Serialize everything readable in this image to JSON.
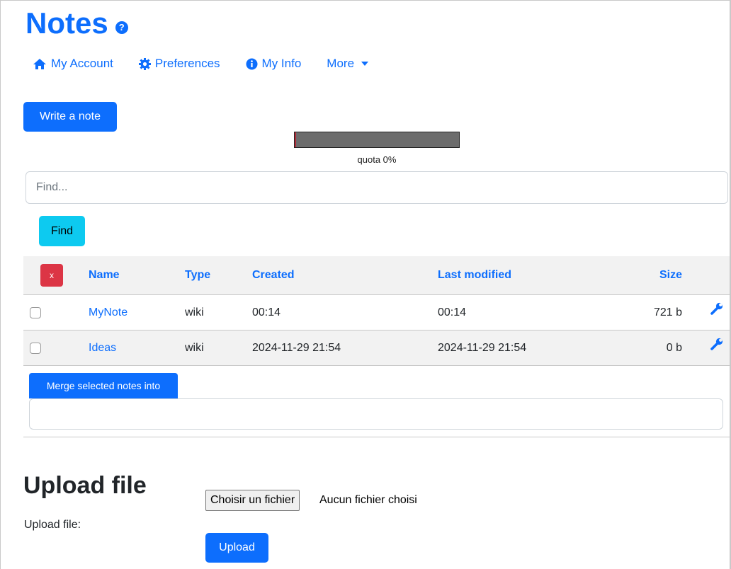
{
  "page": {
    "title": "Notes"
  },
  "nav": {
    "items": [
      {
        "label": "My Account",
        "icon": "home-icon"
      },
      {
        "label": "Preferences",
        "icon": "gear-icon"
      },
      {
        "label": "My Info",
        "icon": "info-icon"
      },
      {
        "label": "More",
        "icon": "caret-down-icon"
      }
    ]
  },
  "actions": {
    "write_note": "Write a note"
  },
  "quota": {
    "label": "quota 0%",
    "percent": 0
  },
  "search": {
    "placeholder": "Find...",
    "button": "Find"
  },
  "table": {
    "delete_label": "x",
    "columns": {
      "name": "Name",
      "type": "Type",
      "created": "Created",
      "modified": "Last modified",
      "size": "Size"
    },
    "rows": [
      {
        "name": "MyNote",
        "type": "wiki",
        "created": "00:14",
        "modified": "00:14",
        "size": "721 b"
      },
      {
        "name": "Ideas",
        "type": "wiki",
        "created": "2024-11-29 21:54",
        "modified": "2024-11-29 21:54",
        "size": "0 b"
      }
    ]
  },
  "merge": {
    "button": "Merge selected notes into"
  },
  "upload": {
    "heading": "Upload file",
    "label": "Upload file:",
    "choose_button": "Choisir un fichier",
    "no_file": "Aucun fichier choisi",
    "submit": "Upload"
  },
  "colors": {
    "primary": "#0d6efd",
    "info": "#0dcaf0",
    "danger": "#dc3545",
    "quota_bar": "#6c6c6c"
  }
}
